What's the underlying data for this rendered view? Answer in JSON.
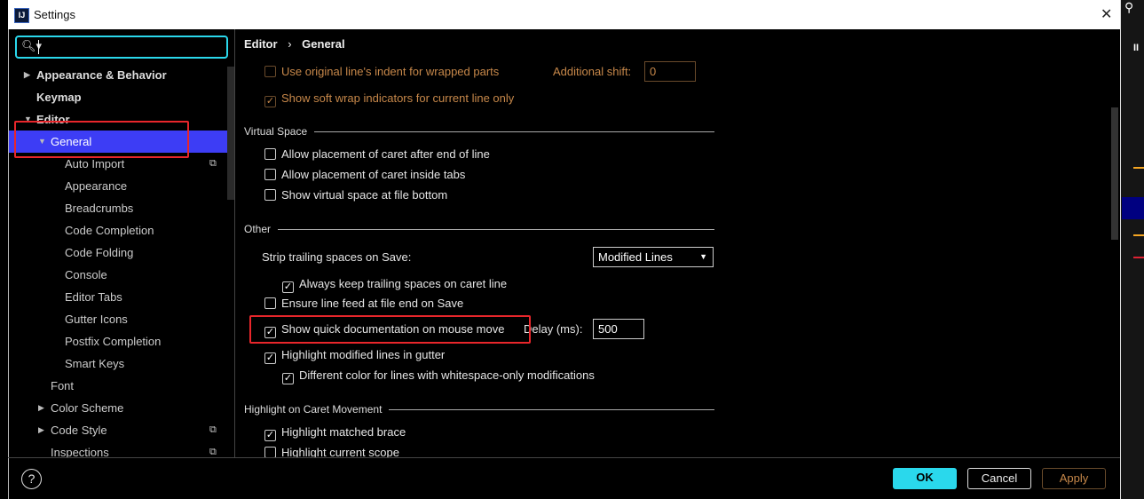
{
  "window": {
    "title": "Settings",
    "logo": "IJ"
  },
  "search": {
    "value": ""
  },
  "tree": [
    {
      "label": "Appearance & Behavior",
      "level": 0,
      "arrow": "right",
      "bold": true
    },
    {
      "label": "Keymap",
      "level": 0,
      "bold": true
    },
    {
      "label": "Editor",
      "level": 0,
      "arrow": "down",
      "bold": true
    },
    {
      "label": "General",
      "level": 1,
      "arrow": "down",
      "selected": true
    },
    {
      "label": "Auto Import",
      "level": 2,
      "copy": true
    },
    {
      "label": "Appearance",
      "level": 2
    },
    {
      "label": "Breadcrumbs",
      "level": 2
    },
    {
      "label": "Code Completion",
      "level": 2
    },
    {
      "label": "Code Folding",
      "level": 2
    },
    {
      "label": "Console",
      "level": 2
    },
    {
      "label": "Editor Tabs",
      "level": 2
    },
    {
      "label": "Gutter Icons",
      "level": 2
    },
    {
      "label": "Postfix Completion",
      "level": 2
    },
    {
      "label": "Smart Keys",
      "level": 2
    },
    {
      "label": "Font",
      "level": 1
    },
    {
      "label": "Color Scheme",
      "level": 1,
      "arrow": "right"
    },
    {
      "label": "Code Style",
      "level": 1,
      "arrow": "right",
      "copy": true
    },
    {
      "label": "Inspections",
      "level": 1,
      "copy": true
    }
  ],
  "breadcrumb": {
    "parent": "Editor",
    "sep": "›",
    "current": "General"
  },
  "content": {
    "use_indent": {
      "label": "Use original line's indent for wrapped parts",
      "checked": false
    },
    "additional_shift": {
      "label": "Additional shift:",
      "value": "0"
    },
    "soft_wrap": {
      "label": "Show soft wrap indicators for current line only",
      "checked": true
    },
    "virtual_space": {
      "title": "Virtual Space",
      "items": [
        {
          "label": "Allow placement of caret after end of line",
          "checked": false
        },
        {
          "label": "Allow placement of caret inside tabs",
          "checked": false
        },
        {
          "label": "Show virtual space at file bottom",
          "checked": false
        }
      ]
    },
    "other": {
      "title": "Other",
      "strip_label": "Strip trailing spaces on Save:",
      "strip_value": "Modified Lines",
      "keep_trailing": {
        "label": "Always keep trailing spaces on caret line",
        "checked": true
      },
      "line_feed": {
        "label": "Ensure line feed at file end on Save",
        "checked": false
      },
      "quick_doc": {
        "label": "Show quick documentation on mouse move",
        "checked": true
      },
      "delay_label": "Delay (ms):",
      "delay_value": "500",
      "highlight_modified": {
        "label": "Highlight modified lines in gutter",
        "checked": true
      },
      "diff_color": {
        "label": "Different color for lines with whitespace-only modifications",
        "checked": true
      }
    },
    "caret": {
      "title": "Highlight on Caret Movement",
      "items": [
        {
          "label": "Highlight matched brace",
          "checked": true
        },
        {
          "label": "Highlight current scope",
          "checked": false
        }
      ]
    }
  },
  "footer": {
    "help": "?",
    "ok": "OK",
    "cancel": "Cancel",
    "apply": "Apply"
  },
  "colors": {
    "accent": "#2ad8ec",
    "selection": "#3d3df5",
    "highlight_box": "#e8262b",
    "disabled_text": "#c7884a"
  }
}
